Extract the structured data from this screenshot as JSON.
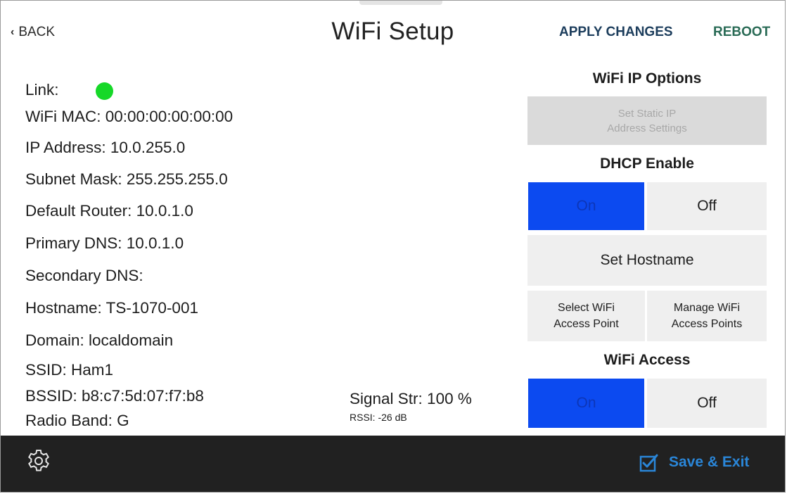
{
  "header": {
    "back_label": "BACK",
    "title": "WiFi Setup",
    "apply_label": "APPLY CHANGES",
    "reboot_label": "REBOOT"
  },
  "info": {
    "link_label": "Link:",
    "link_status_color": "#16d828",
    "wifi_mac": "WiFi MAC: 00:00:00:00:00:00",
    "ip_address": "IP Address: 10.0.255.0",
    "subnet_mask": "Subnet Mask: 255.255.255.0",
    "default_router": "Default Router: 10.0.1.0",
    "primary_dns": "Primary DNS: 10.0.1.0",
    "secondary_dns": "Secondary DNS:",
    "hostname": "Hostname: TS-1070-001",
    "domain": "Domain: localdomain",
    "ssid": "SSID: Ham1",
    "bssid": "BSSID: b8:c7:5d:07:f7:b8",
    "radio_band": "Radio Band: G"
  },
  "signal": {
    "strength": "Signal Str: 100 %",
    "rssi": "RSSI: -26 dB"
  },
  "panel": {
    "ip_options_heading": "WiFi IP Options",
    "static_ip_line1": "Set Static IP",
    "static_ip_line2": "Address Settings",
    "dhcp_heading": "DHCP Enable",
    "dhcp_on": "On",
    "dhcp_off": "Off",
    "set_hostname": "Set Hostname",
    "select_ap_line1": "Select WiFi",
    "select_ap_line2": "Access Point",
    "manage_ap_line1": "Manage WiFi",
    "manage_ap_line2": "Access Points",
    "wifi_access_heading": "WiFi Access",
    "wifi_on": "On",
    "wifi_off": "Off"
  },
  "footer": {
    "settings_icon": "gear-icon",
    "save_icon": "checkbox-icon",
    "save_label": "Save & Exit"
  },
  "colors": {
    "active_toggle": "#0c4af0",
    "footer_bg": "#212121",
    "save_accent": "#2a86d8"
  }
}
